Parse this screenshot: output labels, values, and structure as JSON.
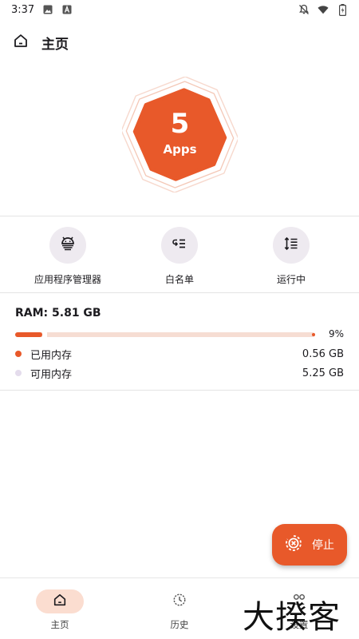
{
  "status": {
    "time": "3:37"
  },
  "header": {
    "title": "主页"
  },
  "badge": {
    "count": "5",
    "label": "Apps"
  },
  "actions": [
    {
      "label": "应用程序管理器",
      "icon": "android-icon"
    },
    {
      "label": "白名单",
      "icon": "whitelist-icon"
    },
    {
      "label": "运行中",
      "icon": "running-icon"
    }
  ],
  "ram": {
    "title": "RAM: 5.81 GB",
    "percent_text": "9%",
    "used_fraction": 0.09,
    "used_label": "已用内存",
    "used_value": "0.56 GB",
    "free_label": "可用内存",
    "free_value": "5.25 GB"
  },
  "fab": {
    "label": "停止",
    "icon": "stop-icon"
  },
  "nav": [
    {
      "label": "主页",
      "icon": "home-icon",
      "active": true
    },
    {
      "label": "历史",
      "icon": "history-icon",
      "active": false
    },
    {
      "label": "设置",
      "icon": "settings-icon",
      "active": false
    }
  ],
  "watermark": {
    "text": "大揆客"
  },
  "colors": {
    "accent": "#e8592a",
    "accent_light": "#fbddd0",
    "track": "#f6ddd3",
    "free_dot": "#e4dcec"
  }
}
